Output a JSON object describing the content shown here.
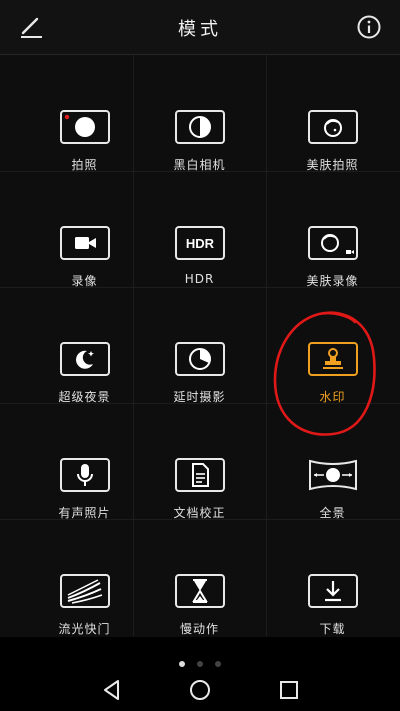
{
  "header": {
    "title": "模式",
    "edit_icon": "edit-icon",
    "info_icon": "info-icon"
  },
  "accent": "#f0a020",
  "modes": [
    {
      "label": "拍照",
      "icon": "photo-icon"
    },
    {
      "label": "黑白相机",
      "icon": "monochrome-icon"
    },
    {
      "label": "美肤拍照",
      "icon": "beauty-photo-icon"
    },
    {
      "label": "录像",
      "icon": "video-icon"
    },
    {
      "label": "HDR",
      "icon": "hdr-icon"
    },
    {
      "label": "美肤录像",
      "icon": "beauty-video-icon"
    },
    {
      "label": "超级夜景",
      "icon": "night-icon"
    },
    {
      "label": "延时摄影",
      "icon": "timelapse-icon"
    },
    {
      "label": "水印",
      "icon": "watermark-icon",
      "selected": true
    },
    {
      "label": "有声照片",
      "icon": "audio-photo-icon"
    },
    {
      "label": "文档校正",
      "icon": "document-icon"
    },
    {
      "label": "全景",
      "icon": "panorama-icon"
    },
    {
      "label": "流光快门",
      "icon": "light-painting-icon"
    },
    {
      "label": "慢动作",
      "icon": "slow-motion-icon"
    },
    {
      "label": "下载",
      "icon": "download-icon"
    }
  ],
  "pager": {
    "pages": 3,
    "current": 1
  },
  "navbar": {
    "back": "back-icon",
    "home": "home-icon",
    "recents": "recents-icon"
  }
}
